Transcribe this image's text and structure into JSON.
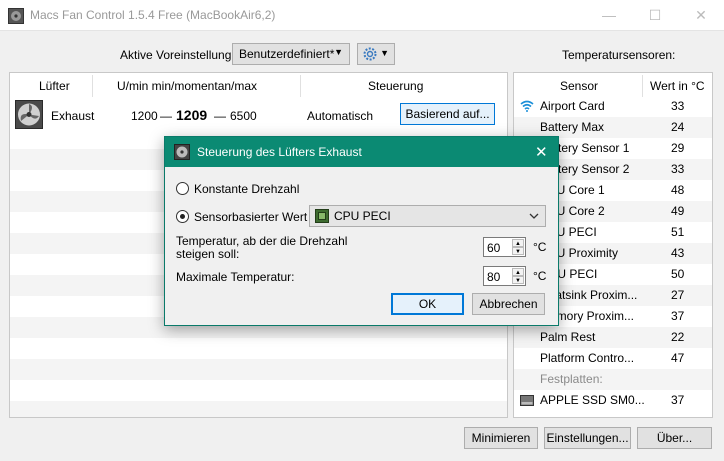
{
  "window": {
    "title": "Macs Fan Control 1.5.4 Free (MacBookAir6,2)",
    "minimize": "—",
    "maximize": "☐",
    "close": "✕"
  },
  "toolbar": {
    "preset_label": "Aktive Voreinstellung:",
    "preset_value": "Benutzerdefiniert*",
    "sensors_title": "Temperatursensoren:"
  },
  "fans": {
    "headers": {
      "fan": "Lüfter",
      "rpm": "U/min min/momentan/max",
      "control": "Steuerung"
    },
    "rows": [
      {
        "name": "Exhaust",
        "min": "1200",
        "current": "1209",
        "max": "6500",
        "sep": "—",
        "mode": "Automatisch",
        "button": "Basierend auf..."
      }
    ]
  },
  "sensors": {
    "headers": {
      "sensor": "Sensor",
      "value": "Wert in °C"
    },
    "rows": [
      {
        "name": "Airport Card",
        "value": "33",
        "icon": "wifi-icon"
      },
      {
        "name": "Battery Max",
        "value": "24"
      },
      {
        "name": "Battery Sensor 1",
        "value": "29"
      },
      {
        "name": "Battery Sensor 2",
        "value": "33"
      },
      {
        "name": "CPU Core 1",
        "value": "48"
      },
      {
        "name": "CPU Core 2",
        "value": "49"
      },
      {
        "name": "CPU PECI",
        "value": "51"
      },
      {
        "name": "CPU Proximity",
        "value": "43"
      },
      {
        "name": "GPU PECI",
        "value": "50"
      },
      {
        "name": "Heatsink Proxim...",
        "value": "27"
      },
      {
        "name": "Memory Proxim...",
        "value": "37"
      },
      {
        "name": "Palm Rest",
        "value": "22"
      },
      {
        "name": "Platform Contro...",
        "value": "47"
      }
    ],
    "disk_section": "Festplatten:",
    "disk_rows": [
      {
        "name": "APPLE SSD SM0...",
        "value": "37",
        "icon": "drive-icon"
      }
    ]
  },
  "buttons": {
    "minimize": "Minimieren",
    "settings": "Einstellungen...",
    "about": "Über..."
  },
  "dialog": {
    "title": "Steuerung des Lüfters Exhaust",
    "close": "✕",
    "option_constant": "Konstante Drehzahl",
    "option_sensor": "Sensorbasierter Wert",
    "selected_option": "sensor",
    "sensor_select": "CPU PECI",
    "temp_start_label": "Temperatur, ab der die Drehzahl steigen soll:",
    "temp_start_value": "60",
    "temp_max_label": "Maximale Temperatur:",
    "temp_max_value": "80",
    "unit": "°C",
    "ok": "OK",
    "cancel": "Abbrechen"
  },
  "colors": {
    "dialog_title_bg": "#0b8a73",
    "ok_border": "#0078d7",
    "selected_button_bg": "#e5f1fb"
  }
}
